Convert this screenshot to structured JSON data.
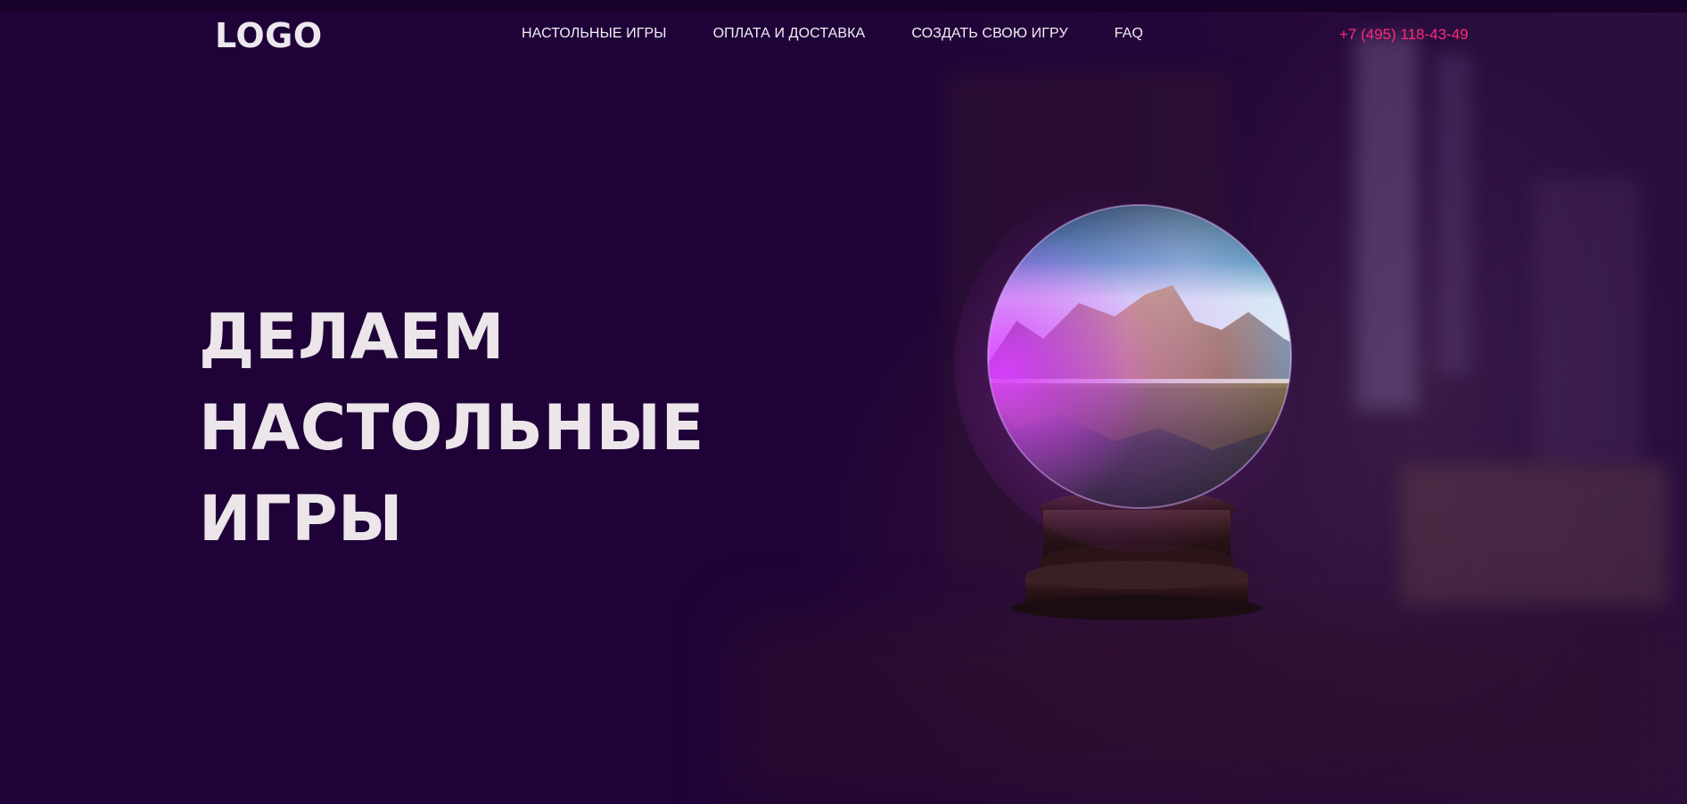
{
  "header": {
    "logo": "LOGO",
    "nav": [
      {
        "label": "НАСТОЛЬНЫЕ ИГРЫ"
      },
      {
        "label": "ОПЛАТА И ДОСТАВКА"
      },
      {
        "label": "СОЗДАТЬ СВОЮ ИГРУ"
      },
      {
        "label": "FAQ"
      }
    ],
    "phone": "+7 (495) 118-43-49"
  },
  "hero": {
    "lines": [
      "ДЕЛАЕМ",
      "НАСТОЛЬНЫЕ",
      "ИГРЫ"
    ]
  },
  "colors": {
    "background": "#1e0436",
    "accent": "#ff2a7a",
    "text": "#ece6ea"
  },
  "icons": {
    "hero_image": "crystal-ball-icon"
  }
}
